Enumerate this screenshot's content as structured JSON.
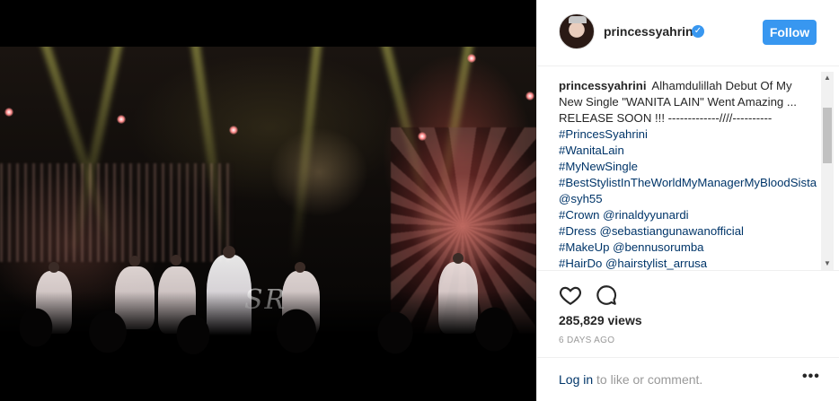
{
  "post": {
    "username": "princessyahrini",
    "follow_label": "Follow",
    "verified_glyph": "✓",
    "caption_user": "princessyahrini",
    "caption_text": "Alhamdulillah Debut Of My New Single \"WANITA LAIN\" Went Amazing ... RELEASE SOON !!! -------------////---------- ",
    "caption_items": [
      {
        "tag": "#PrincesSyahrini",
        "rest": ""
      },
      {
        "tag": "#WanitaLain",
        "rest": ""
      },
      {
        "tag": "#MyNewSingle",
        "rest": ""
      },
      {
        "tag": "#BestStylistInTheWorldMyManagerMyBloodSista",
        "rest": "",
        "mention": "@syh55"
      },
      {
        "tag": "#Crown",
        "mention": "@rinaldyyunardi"
      },
      {
        "tag": "#Dress",
        "mention": "@sebastiangunawanofficial"
      },
      {
        "tag": "#MakeUp",
        "mention": "@bennusorumba"
      },
      {
        "tag": "#HairDo",
        "mention": "@hairstylist_arrusa"
      }
    ],
    "views": "285,829 views",
    "time": "6 DAYS AGO",
    "login_link": "Log in",
    "login_rest": " to like or comment.",
    "more_glyph": "•••",
    "watermark": "SR"
  },
  "icons": {
    "like": "heart-icon",
    "comment": "comment-icon",
    "verified": "verified-badge-icon",
    "more": "more-options-icon"
  },
  "colors": {
    "follow_bg": "#3897f0",
    "link": "#003569",
    "muted": "#999999",
    "text": "#262626"
  }
}
